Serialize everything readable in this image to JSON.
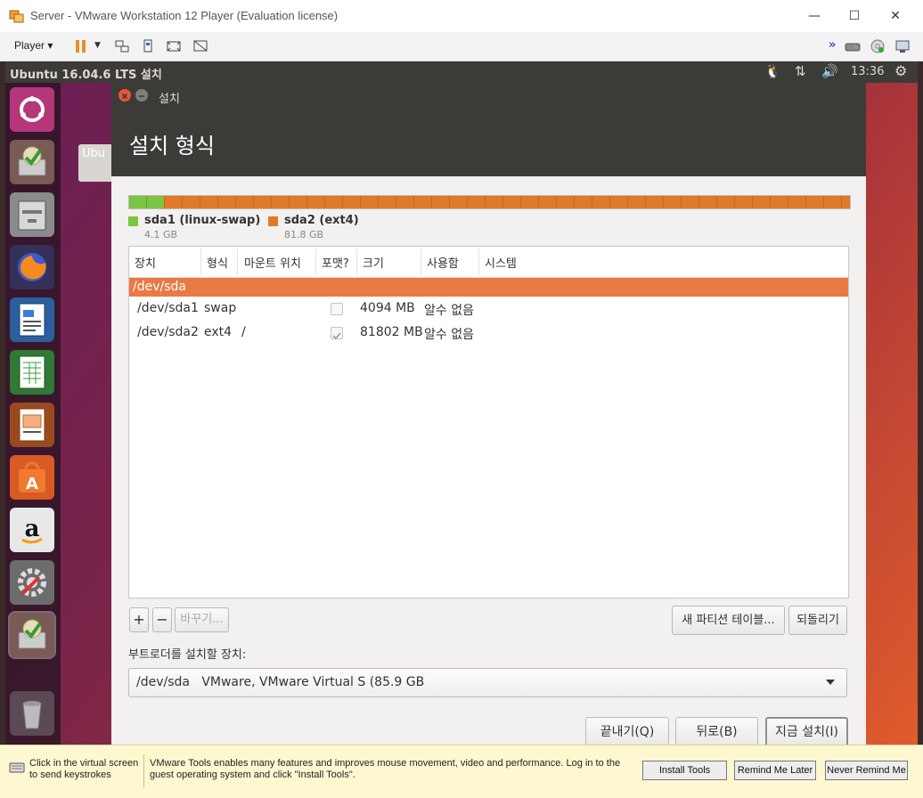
{
  "vmware": {
    "window_title": "Server - VMware Workstation 12 Player (Evaluation license)",
    "player_menu": "Player",
    "minimize": "—",
    "maximize": "☐",
    "close": "✕"
  },
  "ubuntu_panel": {
    "title": "Ubuntu 16.04.6 LTS 설치",
    "clock": "13:36"
  },
  "desktop": {
    "folder_label": "Ubu"
  },
  "installer": {
    "window_title": "설치",
    "heading": "설치 형식",
    "partitions_legend": [
      {
        "name": "sda1 (linux-swap)",
        "size": "4.1 GB",
        "color": "#7cc443"
      },
      {
        "name": "sda2 (ext4)",
        "size": "81.8 GB",
        "color": "#e07a2a"
      }
    ],
    "table": {
      "columns": [
        "장치",
        "형식",
        "마운트 위치",
        "포맷?",
        "크기",
        "사용함",
        "시스템"
      ],
      "selected_device": "/dev/sda",
      "rows": [
        {
          "device": "/dev/sda1",
          "type": "swap",
          "mount": "",
          "format": false,
          "size": "4094 MB",
          "used": "알수 없음",
          "system": ""
        },
        {
          "device": "/dev/sda2",
          "type": "ext4",
          "mount": "/",
          "format": true,
          "size": "81802 MB",
          "used": "알수 없음",
          "system": ""
        }
      ]
    },
    "buttons": {
      "add": "+",
      "remove": "−",
      "change": "바꾸기...",
      "new_table": "새 파티션 테이블...",
      "revert": "되돌리기",
      "quit": "끝내기(Q)",
      "back": "뒤로(B)",
      "install_now": "지금 설치(I)"
    },
    "bootloader_label": "부트로더를 설치할 장치:",
    "bootloader_value": "/dev/sda   VMware, VMware Virtual S (85.9 GB"
  },
  "notification": {
    "hint": "Click in the virtual screen\nto send keystrokes",
    "message": "VMware Tools enables many features and improves mouse movement, video and performance. Log in to the guest operating system and click \"Install Tools\".",
    "install_tools": "Install Tools",
    "remind_later": "Remind Me Later",
    "never_remind": "Never Remind Me"
  }
}
